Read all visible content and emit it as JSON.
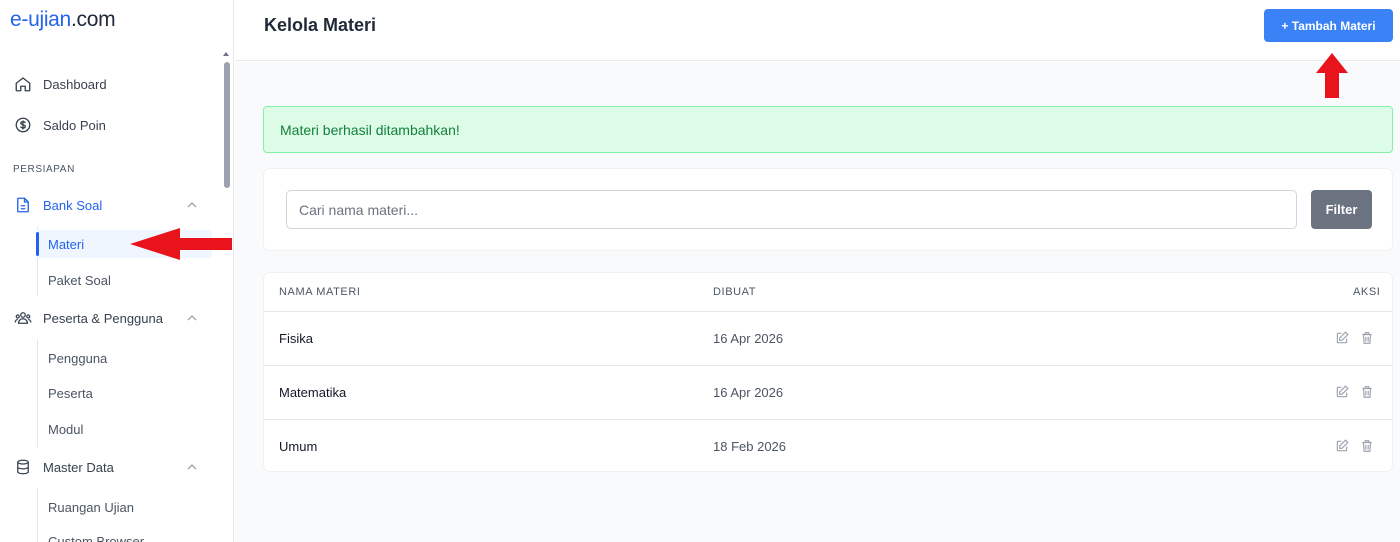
{
  "logo": {
    "brand": "e-ujian",
    "tld": ".com"
  },
  "sidebar": {
    "dashboard": "Dashboard",
    "saldo": "Saldo Poin",
    "section": "PERSIAPAN",
    "bank_soal": "Bank Soal",
    "materi": "Materi",
    "paket_soal": "Paket Soal",
    "peserta_pengguna": "Peserta & Pengguna",
    "pengguna": "Pengguna",
    "peserta": "Peserta",
    "modul": "Modul",
    "master_data": "Master Data",
    "ruangan": "Ruangan Ujian",
    "custom_browser": "Custom Browser"
  },
  "header": {
    "title": "Kelola Materi",
    "add_button": "+ Tambah Materi"
  },
  "alert": {
    "message": "Materi berhasil ditambahkan!"
  },
  "filter": {
    "placeholder": "Cari nama materi...",
    "button": "Filter"
  },
  "table": {
    "columns": [
      "NAMA MATERI",
      "DIBUAT",
      "AKSI"
    ],
    "rows": [
      {
        "name": "Fisika",
        "created": "16 Apr 2026"
      },
      {
        "name": "Matematika",
        "created": "16 Apr 2026"
      },
      {
        "name": "Umum",
        "created": "18 Feb 2026"
      }
    ]
  },
  "colors": {
    "accent": "#3b82f6",
    "alert_bg": "#dcfce7",
    "alert_text": "#15803d",
    "annotation": "#e8131b"
  },
  "icons": {
    "dashboard": "home-icon",
    "saldo": "dollar-circle-icon",
    "bank_soal": "document-icon",
    "peserta": "users-icon",
    "master": "database-icon",
    "edit": "edit-icon",
    "delete": "trash-icon"
  }
}
